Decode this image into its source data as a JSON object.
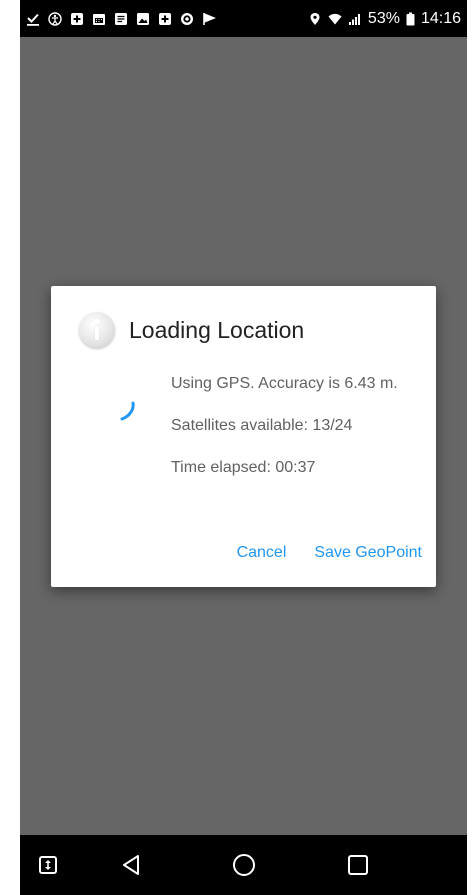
{
  "status_bar": {
    "battery_percent": "53%",
    "time": "14:16",
    "left_icons": [
      "check-download-icon",
      "accessibility-icon",
      "plus-box-icon",
      "calendar-icon",
      "document-icon",
      "image-icon",
      "plus-box-icon",
      "target-icon",
      "flag-icon"
    ],
    "right_icons": [
      "location-pin-icon",
      "wifi-icon",
      "signal-icon",
      "battery-icon"
    ]
  },
  "dialog": {
    "title": "Loading Location",
    "icon": "info-icon",
    "lines": [
      "Using GPS. Accuracy is 6.43 m.",
      "Satellites available: 13/24",
      "Time elapsed: 00:37"
    ],
    "cancel_label": "Cancel",
    "save_label": "Save GeoPoint",
    "accent_color": "#2196F3"
  },
  "nav_bar": {
    "items": [
      "expand-icon",
      "back-icon",
      "home-icon",
      "recents-icon"
    ]
  }
}
